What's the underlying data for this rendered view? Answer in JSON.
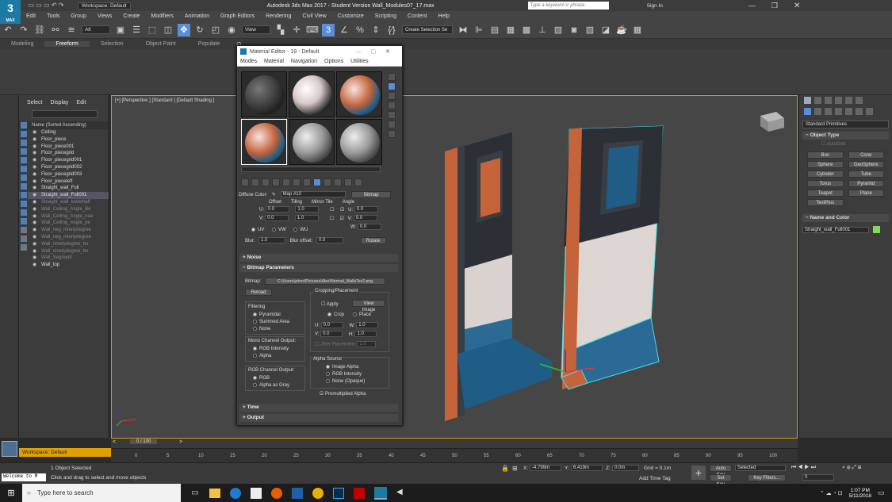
{
  "window": {
    "title": "Autodesk 3ds Max 2017 - Student Version   Wall_Modules07_17.max",
    "workspace_label": "Workspace: Default",
    "search_placeholder": "Type a keyword or phrase",
    "sign_in": "Sign In",
    "app_icon_text": "3",
    "app_icon_sub": "MAX"
  },
  "menu": [
    "Edit",
    "Tools",
    "Group",
    "Views",
    "Create",
    "Modifiers",
    "Animation",
    "Graph Editors",
    "Rendering",
    "Civil View",
    "Customize",
    "Scripting",
    "Content",
    "Help"
  ],
  "toolbar": {
    "selection_filter": "All",
    "view_dropdown": "View",
    "selection_set": "Create Selection Se"
  },
  "ribbon_tabs": [
    "Modeling",
    "Freeform",
    "Selection",
    "Object Paint",
    "Populate"
  ],
  "scene_explorer": {
    "tabs": [
      "Select",
      "Display",
      "Edit"
    ],
    "header": "Name (Sorted Ascending)",
    "items": [
      {
        "name": "Ceiling",
        "dim": false,
        "sel": false
      },
      {
        "name": "Floor_piece",
        "dim": false,
        "sel": false
      },
      {
        "name": "Floor_piece001",
        "dim": false,
        "sel": false
      },
      {
        "name": "Floor_piecegrid",
        "dim": false,
        "sel": false
      },
      {
        "name": "Floor_piecegrid001",
        "dim": false,
        "sel": false
      },
      {
        "name": "Floor_piecegrid002",
        "dim": false,
        "sel": false
      },
      {
        "name": "Floor_piecegrid003",
        "dim": false,
        "sel": false
      },
      {
        "name": "Floor_pieceleft",
        "dim": false,
        "sel": false
      },
      {
        "name": "Straight_wall_Full",
        "dim": false,
        "sel": false
      },
      {
        "name": "Straight_wall_Full001",
        "dim": false,
        "sel": true
      },
      {
        "name": "Straight_wall_lowerhalf",
        "dim": true,
        "sel": false
      },
      {
        "name": "Wall_Ceiling_Angle_Be",
        "dim": true,
        "sel": false
      },
      {
        "name": "Wall_Ceiling_Angle_nee",
        "dim": true,
        "sel": false
      },
      {
        "name": "Wall_Ceiling_Angle_pe",
        "dim": true,
        "sel": false
      },
      {
        "name": "Wall_neg_ninetydegree",
        "dim": true,
        "sel": false
      },
      {
        "name": "Wall_neg_ninetydegree",
        "dim": true,
        "sel": false
      },
      {
        "name": "Wall_ninetydegree_be",
        "dim": true,
        "sel": false
      },
      {
        "name": "Wall_ninetydegree_be",
        "dim": true,
        "sel": false
      },
      {
        "name": "Wall_Segment",
        "dim": true,
        "sel": false
      },
      {
        "name": "Wall_top",
        "dim": false,
        "sel": false
      }
    ]
  },
  "viewport": {
    "label": "[+] [Perspective ] [Standard ] [Default Shading ]"
  },
  "material_editor": {
    "title": "Material Editor - 19 - Default",
    "menu": [
      "Modes",
      "Material",
      "Navigation",
      "Options",
      "Utilities"
    ],
    "diffuse_label": "Diffuse Color:",
    "map_name": "Map #10",
    "map_type": "Bitmap",
    "coord_headers": [
      "Offset",
      "Tiling",
      "Mirror Tile",
      "Angle"
    ],
    "u_label": "U:",
    "v_label": "V:",
    "w_label": "W:",
    "u_offset": "0.0",
    "v_offset": "0.0",
    "u_tiling": "1.0",
    "v_tiling": "1.0",
    "u_angle": "0.0",
    "v_angle": "0.0",
    "w_angle": "0.0",
    "uvw": [
      "UV",
      "VW",
      "WU"
    ],
    "blur_label": "Blur:",
    "blur": "1.0",
    "blur_offset_label": "Blur offset:",
    "blur_offset": "0.0",
    "rotate": "Rotate",
    "noise": "Noise",
    "bitmap_params": "Bitmap Parameters",
    "bitmap_label": "Bitmap:",
    "bitmap_path": "C:\\Users\\johns\\Pictures\\Alex\\Normal_WallsTex2.png",
    "reload": "Reload",
    "cropping": "Cropping/Placement",
    "apply": "Apply",
    "view_image": "View Image",
    "crop": "Crop",
    "place": "Place",
    "u_crop": "0.0",
    "w_crop": "1.0",
    "v_crop": "0.0",
    "h_crop": "1.0",
    "crop_w_label": "W:",
    "crop_h_label": "H:",
    "jitter_label": "Jitter Placement:",
    "jitter": "1.0",
    "filtering": "Filtering",
    "filter_opts": [
      "Pyramidal",
      "Summed Area",
      "None"
    ],
    "mono": "Mono Channel Output:",
    "mono_opts": [
      "RGB Intensity",
      "Alpha"
    ],
    "rgb_out": "RGB Channel Output:",
    "rgb_opts": [
      "RGB",
      "Alpha as Gray"
    ],
    "alpha_source": "Alpha Source",
    "alpha_opts": [
      "Image Alpha",
      "RGB Intensity",
      "None (Opaque)"
    ],
    "premult": "Premultiplied Alpha",
    "time": "Time",
    "output": "Output"
  },
  "command_panel": {
    "dropdown": "Standard Primitives",
    "object_type": "Object Type",
    "autogrid": "AutoGrid",
    "buttons": [
      "Box",
      "Cone",
      "Sphere",
      "GeoSphere",
      "Cylinder",
      "Tube",
      "Torus",
      "Pyramid",
      "Teapot",
      "Plane",
      "TextPlus"
    ],
    "name_color": "Name and Color",
    "object_name": "Straight_wall_Full001",
    "object_color": "#7ed957"
  },
  "timeline": {
    "frame": "0 / 100",
    "ticks": [
      "0",
      "5",
      "10",
      "15",
      "20",
      "25",
      "30",
      "35",
      "40",
      "45",
      "50",
      "55",
      "60",
      "65",
      "70",
      "75",
      "80",
      "85",
      "90",
      "95",
      "100"
    ]
  },
  "status": {
    "selected": "1 Object Selected",
    "hint": "Click and drag to select and move objects",
    "welcome": "Welcome to M",
    "x_label": "X:",
    "x": "-4.799m",
    "y_label": "Y:",
    "y": "6.419m",
    "z_label": "Z:",
    "z": "0.0m",
    "grid": "Grid = 0.1m",
    "add_time_tag": "Add Time Tag",
    "auto_key": "Auto Key",
    "set_key": "Set Key",
    "selected_dd": "Selected",
    "key_filters": "Key Filters...",
    "frame_field": "0"
  },
  "taskbar": {
    "search_placeholder": "Type here to search",
    "time": "1:07 PM",
    "date": "5/11/2018"
  }
}
